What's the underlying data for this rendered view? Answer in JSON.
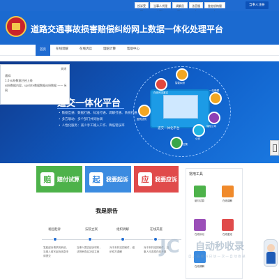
{
  "topbar": {
    "links": [
      "投诉受理",
      "当事人代理人服务",
      "调解员服务",
      "法官服务",
      "鉴定机构服务"
    ],
    "register_label": "当事人注册"
  },
  "header": {
    "title": "道路交通事故损害赔偿纠纷网上数据一体化处理平台"
  },
  "nav": {
    "items": [
      "首页",
      "在线调解",
      "在线诉讼",
      "理赔计算",
      "帮助中心"
    ],
    "active": "首页"
  },
  "notice": {
    "close_label": "关闭",
    "lines": [
      "通知:",
      "1.0 纠纷数据已经上线",
      "纠纷数据内容，update数据数据纠纷数据 —— 另网"
    ]
  },
  "banner": {
    "title": "道交一体化平台",
    "bullets": [
      "数据互通：数据打通、标准打通、调解打通、系统打通",
      "多方联动：多个部门共同协调",
      "人性化服务：减少手工输入工作、降低错误率"
    ],
    "platform_label": "道交一体化平台",
    "nodes": [
      "在线司法鉴定",
      "智能纠纷",
      "医院法院",
      "一站受理",
      "保险公司",
      "交警",
      "公安"
    ]
  },
  "cards": [
    {
      "label": "赔付试算",
      "icon_char": "赔",
      "color": "#4db24a"
    },
    {
      "label": "我要起诉",
      "icon_char": "起",
      "color": "#3b8be0"
    },
    {
      "label": "我要应诉",
      "icon_char": "应",
      "color": "#e04b4b"
    }
  ],
  "side_panel": {
    "title": "常用工具",
    "tools": [
      {
        "label": "赔付试算",
        "color": "#4db24a"
      },
      {
        "label": "在线调解",
        "color": "#f08a2b"
      },
      {
        "label": "在线诉讼",
        "color": "#9b4fb8"
      },
      {
        "label": "在线鉴定",
        "color": "#e04b4b"
      },
      {
        "label": "在线调解",
        "color": "#3b8be0"
      }
    ]
  },
  "process": {
    "title": "我是原告",
    "steps": [
      {
        "label": "发起起诉",
        "desc": "发起起诉请求到系统，当事人填写起诉信息申请提交"
      },
      {
        "label": "法院立案",
        "desc": "当事人提交起诉材料，法院审查后决定立案"
      },
      {
        "label": "组织调解",
        "desc": "对于未判定的案件，组织双方调解"
      },
      {
        "label": "在线开庭",
        "desc": "对于未判定的案件，当事人可选择在线开庭"
      }
    ]
  },
  "watermark": {
    "logo": "JC",
    "text": "自动秒收录",
    "sub": "自 上 链 接 每 日 访 一 次 一 自 动 收 录"
  }
}
